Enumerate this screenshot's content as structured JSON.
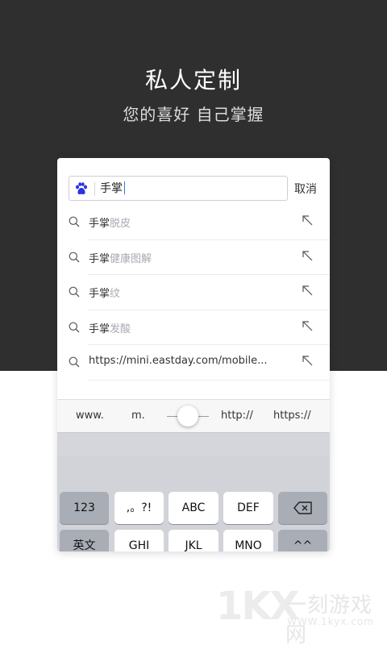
{
  "hero": {
    "title": "私人定制",
    "subtitle": "您的喜好 自己掌握"
  },
  "search": {
    "engine_icon": "baidu-paw-icon",
    "query": "手掌",
    "cancel_label": "取消"
  },
  "suggestions": [
    {
      "prefix": "手掌",
      "hint": "脱皮"
    },
    {
      "prefix": "手掌",
      "hint": "健康图解"
    },
    {
      "prefix": "手掌",
      "hint": "纹"
    },
    {
      "prefix": "手掌",
      "hint": "发酸"
    },
    {
      "prefix": "https://mini.eastday.com/mobile...",
      "hint": ""
    }
  ],
  "shortcuts": {
    "www": "www.",
    "m": "m.",
    "http": "http://",
    "https": "https://"
  },
  "keyboard": {
    "row1": [
      "123",
      ",。?!",
      "ABC",
      "DEF"
    ],
    "row2": [
      "英文",
      "GHI",
      "JKL",
      "MNO",
      "^^"
    ]
  },
  "watermark": {
    "logo": "1KX",
    "name": "一刻游戏网",
    "url": "WWW.1kyx.com"
  },
  "colors": {
    "hero_bg": "#2f2f2f",
    "baidu_blue": "#2932e1",
    "caret": "#2a7be4"
  }
}
